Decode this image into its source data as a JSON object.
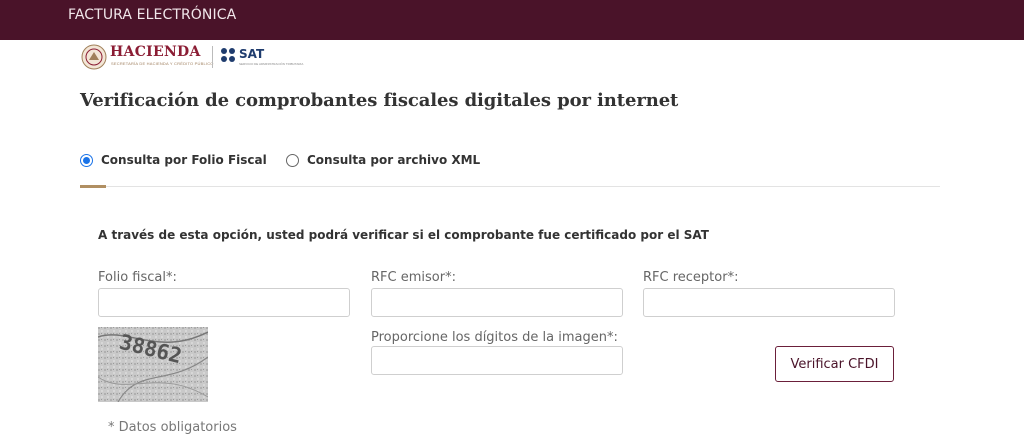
{
  "header": {
    "title": "FACTURA ELECTRÓNICA"
  },
  "logos": {
    "hacienda_word": "HACIENDA",
    "hacienda_sub": "SECRETARÍA DE HACIENDA Y CRÉDITO PÚBLICO",
    "sat_word": "SAT",
    "sat_sub": "SERVICIO DE ADMINISTRACIÓN TRIBUTARIA"
  },
  "page_title": "Verificación de comprobantes fiscales digitales por internet",
  "options": {
    "folio": {
      "label": "Consulta por Folio Fiscal",
      "selected": true
    },
    "xml": {
      "label": "Consulta por archivo XML",
      "selected": false
    }
  },
  "intro": "A través de esta opción, usted podrá verificar si el comprobante fue certificado por el SAT",
  "form": {
    "folio_label": "Folio fiscal*:",
    "folio_value": "",
    "emisor_label": "RFC emisor*:",
    "emisor_value": "",
    "receptor_label": "RFC receptor*:",
    "receptor_value": "",
    "captcha_label": "Proporcione los dígitos de la imagen*:",
    "captcha_value": "",
    "captcha_text": "38862",
    "verify_label": "Verificar CFDI",
    "required_note": "* Datos obligatorios"
  },
  "colors": {
    "header_bg": "#4a1329",
    "accent": "#b08f62",
    "brand": "#6b1f3a",
    "radio": "#1a73e8"
  }
}
